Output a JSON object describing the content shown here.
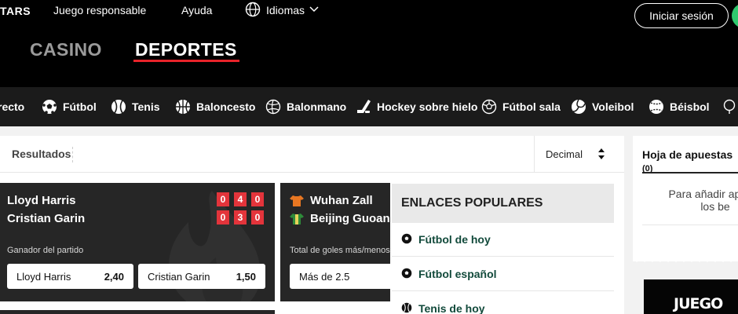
{
  "header": {
    "brand": "TARS",
    "links": [
      "Juego responsable",
      "Ayuda",
      "Idiomas"
    ],
    "login": "Iniciar sesión",
    "tabs": [
      "CASINO",
      "DEPORTES"
    ]
  },
  "sports_nav": [
    {
      "label": "recto",
      "icon": "live-icon"
    },
    {
      "label": "Fútbol",
      "icon": "soccer-ball-icon"
    },
    {
      "label": "Tenis",
      "icon": "tennis-ball-icon"
    },
    {
      "label": "Baloncesto",
      "icon": "basketball-icon"
    },
    {
      "label": "Balonmano",
      "icon": "handball-icon"
    },
    {
      "label": "Hockey sobre hielo",
      "icon": "hockey-stick-icon"
    },
    {
      "label": "Fútbol sala",
      "icon": "futsal-ball-icon"
    },
    {
      "label": "Voleibol",
      "icon": "volleyball-icon"
    },
    {
      "label": "Béisbol",
      "icon": "baseball-icon"
    }
  ],
  "results": {
    "title": "Resultados",
    "odds_format": "Decimal"
  },
  "cards": [
    {
      "team1": "Lloyd Harris",
      "team2": "Cristian Garin",
      "score1": [
        "0",
        "4",
        "0"
      ],
      "score2": [
        "0",
        "3",
        "0"
      ],
      "market": "Ganador del partido",
      "odds": [
        {
          "selection": "Lloyd Harris",
          "price": "2,40"
        },
        {
          "selection": "Cristian Garin",
          "price": "1,50"
        }
      ]
    },
    {
      "team1": "Wuhan Zall",
      "team2": "Beijing Guoan",
      "market": "Total de goles más/menos",
      "odds": [
        {
          "selection": "Más de 2.5",
          "price": ""
        }
      ]
    }
  ],
  "popular": {
    "title": "ENLACES POPULARES",
    "items": [
      {
        "label": "Fútbol de hoy",
        "icon": "soccer-ball-icon"
      },
      {
        "label": "Fútbol español",
        "icon": "soccer-ball-icon"
      },
      {
        "label": "Tenis de hoy",
        "icon": "tennis-ball-icon"
      }
    ]
  },
  "betslip": {
    "title": "Hoja de apuestas",
    "count": "(0)",
    "message": "Para añadir apu en los be"
  },
  "promo": {
    "text": "JUEGO"
  },
  "colors": {
    "accent": "#e8232a",
    "link_green": "#124a3b",
    "score_red": "#e3343b"
  }
}
